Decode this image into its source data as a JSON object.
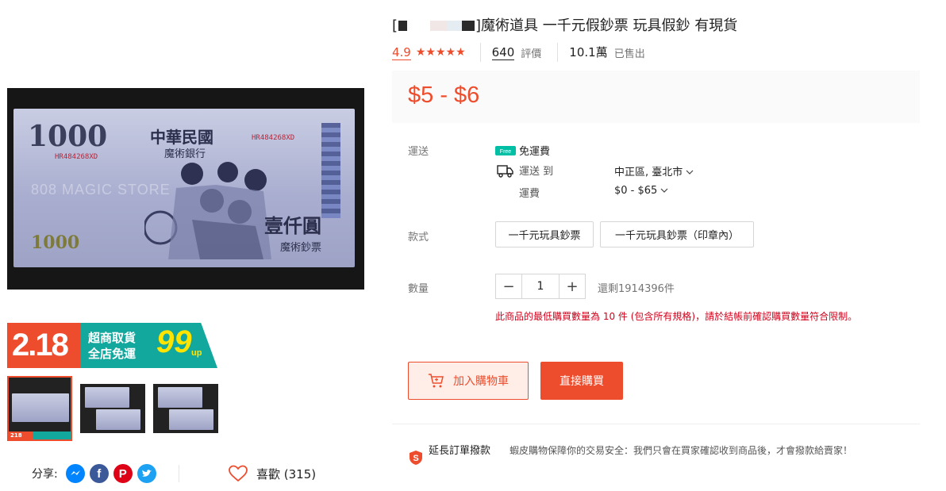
{
  "product": {
    "title_bracket_open": "[",
    "title": "]魔術道具 一千元假鈔票 玩具假鈔 有現貨",
    "rating": "4.9",
    "stars": "★★★★★",
    "reviews_count": "640",
    "reviews_label": "評價",
    "sold_count": "10.1萬",
    "sold_label": "已售出",
    "price": "$5 - $6"
  },
  "gallery": {
    "main_image": {
      "denomination": "1000",
      "bank_name": "中華民國",
      "bank_sub": "魔術銀行",
      "serial": "HR484268XD",
      "watermark": "808 MAGIC STORE",
      "denom_chars": "壹仟圓",
      "caption": "魔術鈔票"
    },
    "promo": {
      "number": "2.18",
      "line1": "超商取貨",
      "line2": "全店免運",
      "big": "99",
      "up": "up"
    },
    "thumb_badge": "218"
  },
  "share": {
    "label": "分享:",
    "icons": [
      "messenger-icon",
      "facebook-icon",
      "pinterest-icon",
      "twitter-icon"
    ]
  },
  "like": {
    "label": "喜歡 (315)"
  },
  "shipping": {
    "label": "運送",
    "free_badge": "Free",
    "free_text": "免運費",
    "ship_to_label": "運送 到",
    "destination": "中正區, 臺北市",
    "fee_label": "運費",
    "fee": "$0 - $65"
  },
  "variations": {
    "label": "款式",
    "options": [
      "一千元玩具鈔票",
      "一千元玩具鈔票（印章內）"
    ]
  },
  "quantity": {
    "label": "數量",
    "minus": "−",
    "value": "1",
    "plus": "+",
    "stock": "還剩1914396件",
    "notice": "此商品的最低購買數量為 10 件 (包含所有規格)，請於結帳前確認購買數量符合限制。"
  },
  "actions": {
    "add_to_cart": "加入購物車",
    "buy_now": "直接購買"
  },
  "guarantee": {
    "title": "延長訂單撥款",
    "text": "蝦皮購物保障你的交易安全：我們只會在買家確認收到商品後，才會撥款給賣家！"
  },
  "colors": {
    "accent": "#ee4d2d",
    "promo_teal": "#13a89e",
    "notice_red": "#d0011b"
  }
}
